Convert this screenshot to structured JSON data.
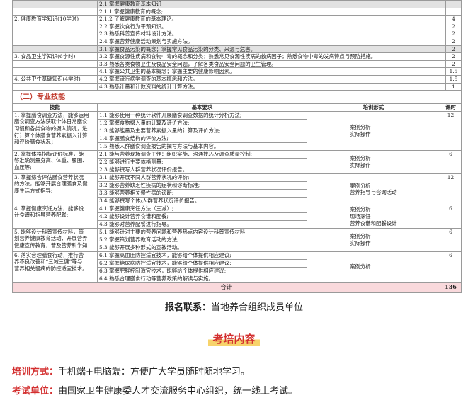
{
  "top_rows": [
    {
      "no": "",
      "detail": "2.1  掌握健康教育基本知识",
      "hours": "",
      "shade": true
    },
    {
      "no": "",
      "detail": "2.1.1  掌握健康教育的概念;",
      "hours": "",
      "shade": false
    },
    {
      "no": "2. 健康教育学知识(10学时)",
      "detail": "2.1.2  了解健康教育的基本理论。",
      "hours": "4",
      "shade": false
    },
    {
      "no": "",
      "detail": "2.2  掌握饮食行为干预知识。",
      "hours": "2",
      "shade": false
    },
    {
      "no": "",
      "detail": "2.3  熟悉科普宣传材料设计方法。",
      "hours": "2",
      "shade": false
    },
    {
      "no": "",
      "detail": "2.4  掌握营养健康活动策划与实施方法。",
      "hours": "2",
      "shade": false
    },
    {
      "no": "",
      "detail": "3.1  掌握食品污染的概念；掌握常见食品污染的分类、来源与危害。",
      "hours": "2",
      "shade": true
    },
    {
      "no": "3. 食品卫生学知识(6学时)",
      "detail": "3.2  掌握食源性疾病和食物中毒的概念和分类；熟悉常见食源性疾病的救病因子；熟悉食物中毒的发病特点与预防措施。",
      "hours": "2",
      "shade": false
    },
    {
      "no": "",
      "detail": "3.3  熟悉各类食物卫生及食品安全问题，了解各类食品安全问题的卫生管理。",
      "hours": "2",
      "shade": false
    },
    {
      "no": "",
      "detail": "4.1  掌握公共卫生的基本概念；掌握主要的健康影响因素。",
      "hours": "1.5",
      "shade": false
    },
    {
      "no": "4. 公共卫生基础知识(4学时)",
      "detail": "4.2  掌握流行病学调查的基本概念和方法。",
      "hours": "1.5",
      "shade": false
    },
    {
      "no": "",
      "detail": "4.3  熟悉计量和计数资料的统计计算方法。",
      "hours": "1",
      "shade": false
    }
  ],
  "section_title": "（二）专业技能",
  "headers": {
    "skill": "技能",
    "req": "基本要求",
    "form": "培训形式",
    "hours": "课时"
  },
  "groups": [
    {
      "skill": [
        "1. 掌握膳食调查方法，能够运用",
        "膳食调查方法获取个体日常膳食",
        "习惯和各类食物的摄入情况，进",
        "行计算个体膳食营养素摄入计算",
        "和评价膳食状况；"
      ],
      "reqs": [
        "1.1  能够使用一种统计软件开展膳食调查数据的统计分析方法;",
        "1.2  掌握食物摄入量的计算及评价方法;",
        "1.3  能够能量及主要营养素摄入量的计算及评价方法;",
        "1.4  掌握膳食结构的评价方法;",
        "1.5  熟悉人群膳食调查报告的撰写方法与基本内容。"
      ],
      "form": [
        "案例分析",
        "实际操作"
      ],
      "hours": "12"
    },
    {
      "skill": [
        "2.  掌握体格指标评价标准，能",
        "够准确测量身高、体重、腰围、",
        "血压等;"
      ],
      "reqs": [
        "2.1  能与营养现场调查工作：组织实施、沟通技巧及调查质量控制;",
        "2.2  能够进行主要体格测量;",
        "2.3  能够撰写人群营养状况评价报告。"
      ],
      "form": [
        "案例分析",
        "实际操作"
      ],
      "hours": "6"
    },
    {
      "skill": [
        "3.  掌握综合评估膳食营养状况",
        "的方法，能够开展合理膳食及健",
        "康生活方式指导;"
      ],
      "reqs": [
        "3.1  能够开展不同人群营养状况的评价;",
        "3.2  能够营养缺乏性疾病的症状和诊断标准;",
        "3.3  能够营养相关慢性病的诊断;",
        "3.4  能够撰写个体/人群营养状况评价报告。"
      ],
      "form": [
        "案例分析",
        "营养指导与咨询活动"
      ],
      "hours": "12"
    },
    {
      "skill": [
        "4.  掌握健康烹饪方法，能够设",
        "计食谱和指导营养配餐;"
      ],
      "reqs": [
        "4.1  掌握健康烹饪方法（三减）;",
        "4.2  能够设计营养食谱和配餐;",
        "4.3  能够对营养配餐进行指导。"
      ],
      "form": [
        "案例分析",
        "现场烹饪",
        "营养食谱和配餐设计"
      ],
      "hours": "6"
    },
    {
      "skill": [
        "5.  能够设计科普宣传材料，策",
        "划营养健康教育活动，开展营养",
        "健康宣传教育，普及营养科学知"
      ],
      "reqs": [
        "5.1  能够针对主要的营养问题和营养热点内容设计科普宣传材料;",
        "5.2  掌握策划营养教育活动的方法;",
        "5.3  能够开展多种形式的宣教活动。"
      ],
      "form": [
        "案例分析",
        "实际操作"
      ],
      "hours": "6"
    },
    {
      "skill": [
        "6.  落实合理膳食行动，推行营",
        "养不良改善和“三减三健”等与",
        "营养相关慢病的防控适宜技术。"
      ],
      "reqs": [
        "6.1  掌握高血压防控适宜技术，能够给个体提供相应建议;",
        "6.2  掌握糖尿病防控适宜技术，能够给个体提供相应建议;",
        "6.3  掌握肥胖控制适宜技术，能够给个体提供相应建议;",
        "6.4  熟悉合理膳食行动等营养政策的解读与实施。"
      ],
      "form": [
        "案例分析"
      ],
      "hours": "6"
    }
  ],
  "total": {
    "label": "合计",
    "hours": "136"
  },
  "registration": {
    "label": "报名联系：",
    "value": "当地养合组织成员单位"
  },
  "banner": "考培内容",
  "training": {
    "label": "培训方式：",
    "value": "手机端+电脑端：方便广大学员随时随地学习。"
  },
  "exam": {
    "label": "考试单位：",
    "value": "由国家卫生健康委人才交流服务中心组织，统一线上考试。"
  }
}
